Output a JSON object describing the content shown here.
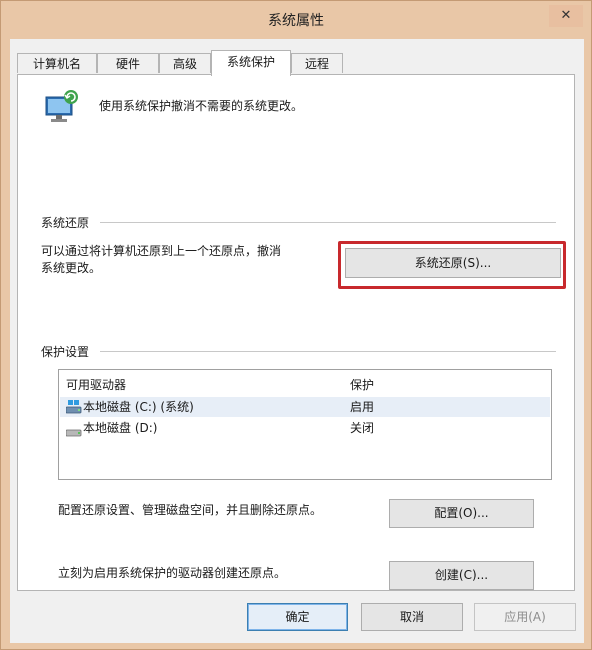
{
  "window": {
    "title": "系统属性",
    "close_glyph": "✕"
  },
  "tabs": [
    {
      "label": "计算机名",
      "active": false
    },
    {
      "label": "硬件",
      "active": false
    },
    {
      "label": "高级",
      "active": false
    },
    {
      "label": "系统保护",
      "active": true
    },
    {
      "label": "远程",
      "active": false
    }
  ],
  "intro": {
    "text": "使用系统保护撤消不需要的系统更改。",
    "icon": "system-protection-icon"
  },
  "restore_section": {
    "title": "系统还原",
    "description_line1": "可以通过将计算机还原到上一个还原点，撤消",
    "description_line2": "系统更改。",
    "button_label": "系统还原(S)...",
    "highlight_color": "#c8292d"
  },
  "protection_section": {
    "title": "保护设置",
    "columns": [
      "可用驱动器",
      "保护"
    ],
    "drives": [
      {
        "name": "本地磁盘 (C:) (系统)",
        "protection": "启用",
        "icon": "system-drive-icon",
        "selected": true
      },
      {
        "name": "本地磁盘 (D:)",
        "protection": "关闭",
        "icon": "drive-icon",
        "selected": false
      }
    ],
    "configure_text": "配置还原设置、管理磁盘空间，并且删除还原点。",
    "configure_button": "配置(O)...",
    "create_text": "立刻为启用系统保护的驱动器创建还原点。",
    "create_button": "创建(C)..."
  },
  "footer": {
    "ok_label": "确定",
    "cancel_label": "取消",
    "apply_label": "应用(A)"
  }
}
